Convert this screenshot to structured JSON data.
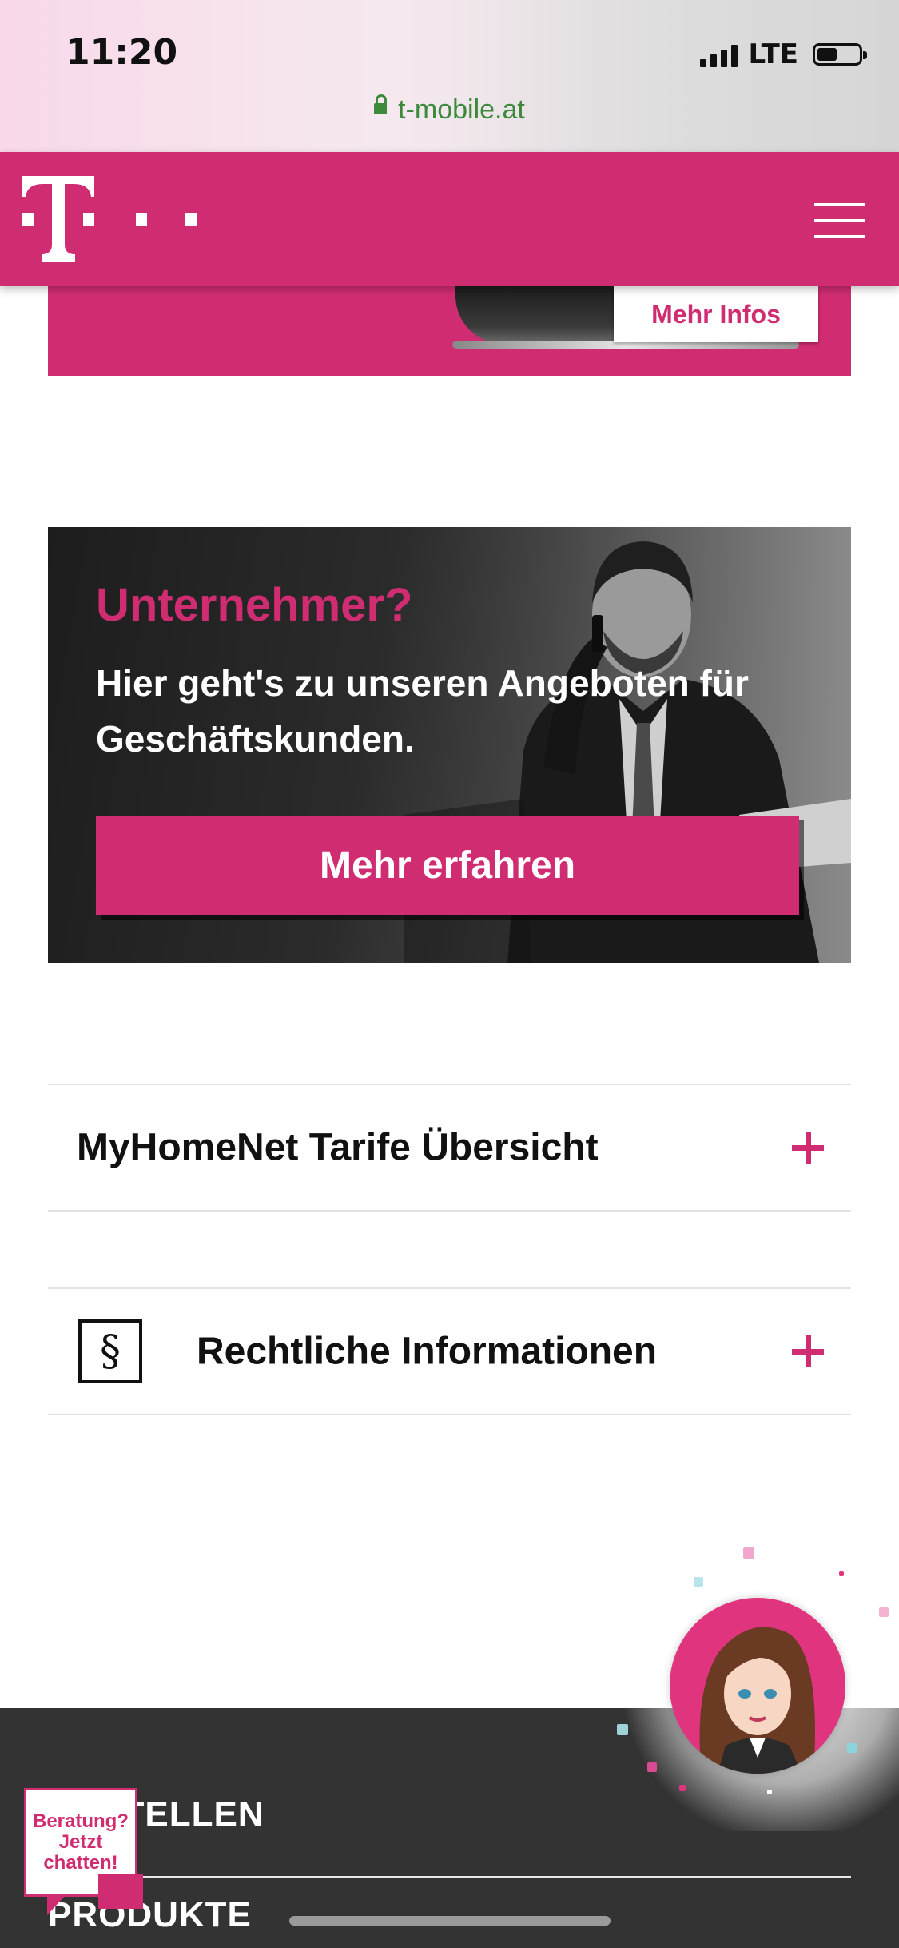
{
  "status_bar": {
    "time": "11:20",
    "network": "LTE",
    "url": "t-mobile.at"
  },
  "header": {
    "logo_alt": "T · · ·",
    "menu_icon": "hamburger-menu-icon"
  },
  "promo": {
    "button_label": "Mehr Infos"
  },
  "business": {
    "title": "Unternehmer?",
    "text": "Hier geht's zu unseren Angeboten für Geschäftskunden.",
    "button_label": "Mehr erfahren"
  },
  "accordions": [
    {
      "label": "MyHomeNet Tarife Übersicht",
      "icon": "plus-icon"
    },
    {
      "label": "Rechtliche Informationen",
      "icon": "plus-icon",
      "leading_icon": "§"
    }
  ],
  "footer": {
    "items": [
      "BESTELLEN",
      "PRODUKTE"
    ]
  },
  "chat": {
    "line1": "Beratung?",
    "line2": "Jetzt",
    "line3": "chatten!"
  },
  "colors": {
    "brand_magenta": "#d02c72",
    "footer_bg": "#333333",
    "url_green": "#3d8a3d"
  }
}
